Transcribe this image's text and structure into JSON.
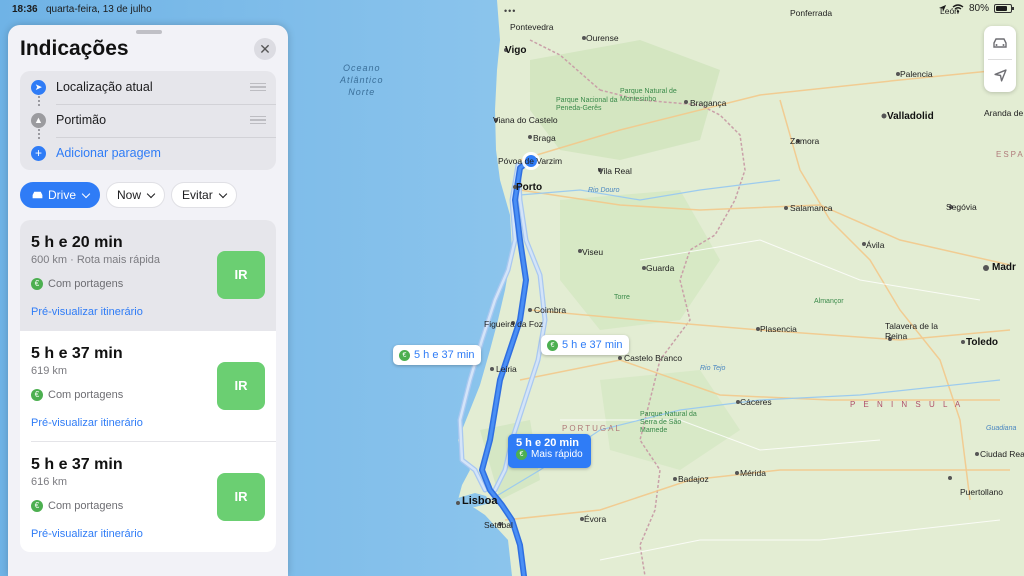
{
  "status_bar": {
    "time": "18:36",
    "date": "quarta-feira, 13 de julho",
    "battery": "80%"
  },
  "panel": {
    "title": "Indicações",
    "stops": [
      {
        "label": "Localização atual",
        "icon": "location-arrow-icon"
      },
      {
        "label": "Portimão",
        "icon": "landmark-icon"
      }
    ],
    "add_stop": "Adicionar paragem",
    "chips": {
      "mode": "Drive",
      "time": "Now",
      "avoid": "Evitar"
    },
    "routes": [
      {
        "time": "5 h e 20 min",
        "info": "600 km · Rota mais rápida",
        "toll": "Com portagens",
        "preview": "Pré-visualizar itinerário",
        "go": "IR",
        "selected": true
      },
      {
        "time": "5 h e 37 min",
        "info": "619 km",
        "toll": "Com portagens",
        "preview": "Pré-visualizar itinerário",
        "go": "IR",
        "selected": false
      },
      {
        "time": "5 h e 37 min",
        "info": "616 km",
        "toll": "Com portagens",
        "preview": "Pré-visualizar itinerário",
        "go": "IR",
        "selected": false
      }
    ]
  },
  "map": {
    "route_labels": {
      "left_alt": "5 h e 37 min",
      "right_alt": "5 h e 37 min",
      "main_time": "5 h e 20 min",
      "main_sub": "Mais rápido"
    },
    "ocean": [
      "Oceano",
      "Atlântico",
      "Norte"
    ],
    "places": {
      "pontevedra": "Pontevedra",
      "vigo": "Vigo",
      "ourense": "Ourense",
      "ponferrada": "Ponferrada",
      "leon": "León",
      "palencia": "Palencia",
      "valladolid": "Valladolid",
      "aranda": "Aranda de",
      "zamora": "Zamora",
      "braganca": "Bragança",
      "viana": "Viana do Castelo",
      "braga": "Braga",
      "povoa": "Póvoa de Varzim",
      "vila_real": "Vila Real",
      "porto": "Porto",
      "salamanca": "Salamanca",
      "segovia": "Segóvia",
      "espanha": "ESPA",
      "viseu": "Viseu",
      "guarda": "Guarda",
      "avila": "Ávila",
      "madrid": "Madr",
      "coimbra": "Coimbra",
      "figueira": "Figueira da Foz",
      "plasencia": "Plasencia",
      "talavera": "Talavera de la Reina",
      "toledo": "Toledo",
      "leiria": "Leiria",
      "castelo_branco": "Castelo Branco",
      "caceres": "Cáceres",
      "portugal": "PORTUGAL",
      "peninsula": "P E N I N S U L A",
      "lisboa": "Lisboa",
      "setubal": "Setúbal",
      "evora": "Évora",
      "badajoz": "Badajoz",
      "merida": "Mérida",
      "ciudad_real": "Ciudad Real",
      "puertollano": "Puertollano",
      "torre": "Torre",
      "almancor": "Almançor"
    },
    "parks": {
      "geres": "Parque Nacional da Peneda-Gerês",
      "montesinho": "Parque Natural de Montesinho",
      "mamede": "Parque Natural da Serra de São Mamede"
    },
    "rivers": {
      "douro": "Rio Douro",
      "tejo": "Rio Tejo",
      "guadiana": "Guadiana"
    }
  },
  "colors": {
    "accent": "#2f7cf6",
    "go": "#6bcf72",
    "toll": "#4caf50",
    "land": "#e6efd6",
    "ocean": "#8cc4ea"
  }
}
